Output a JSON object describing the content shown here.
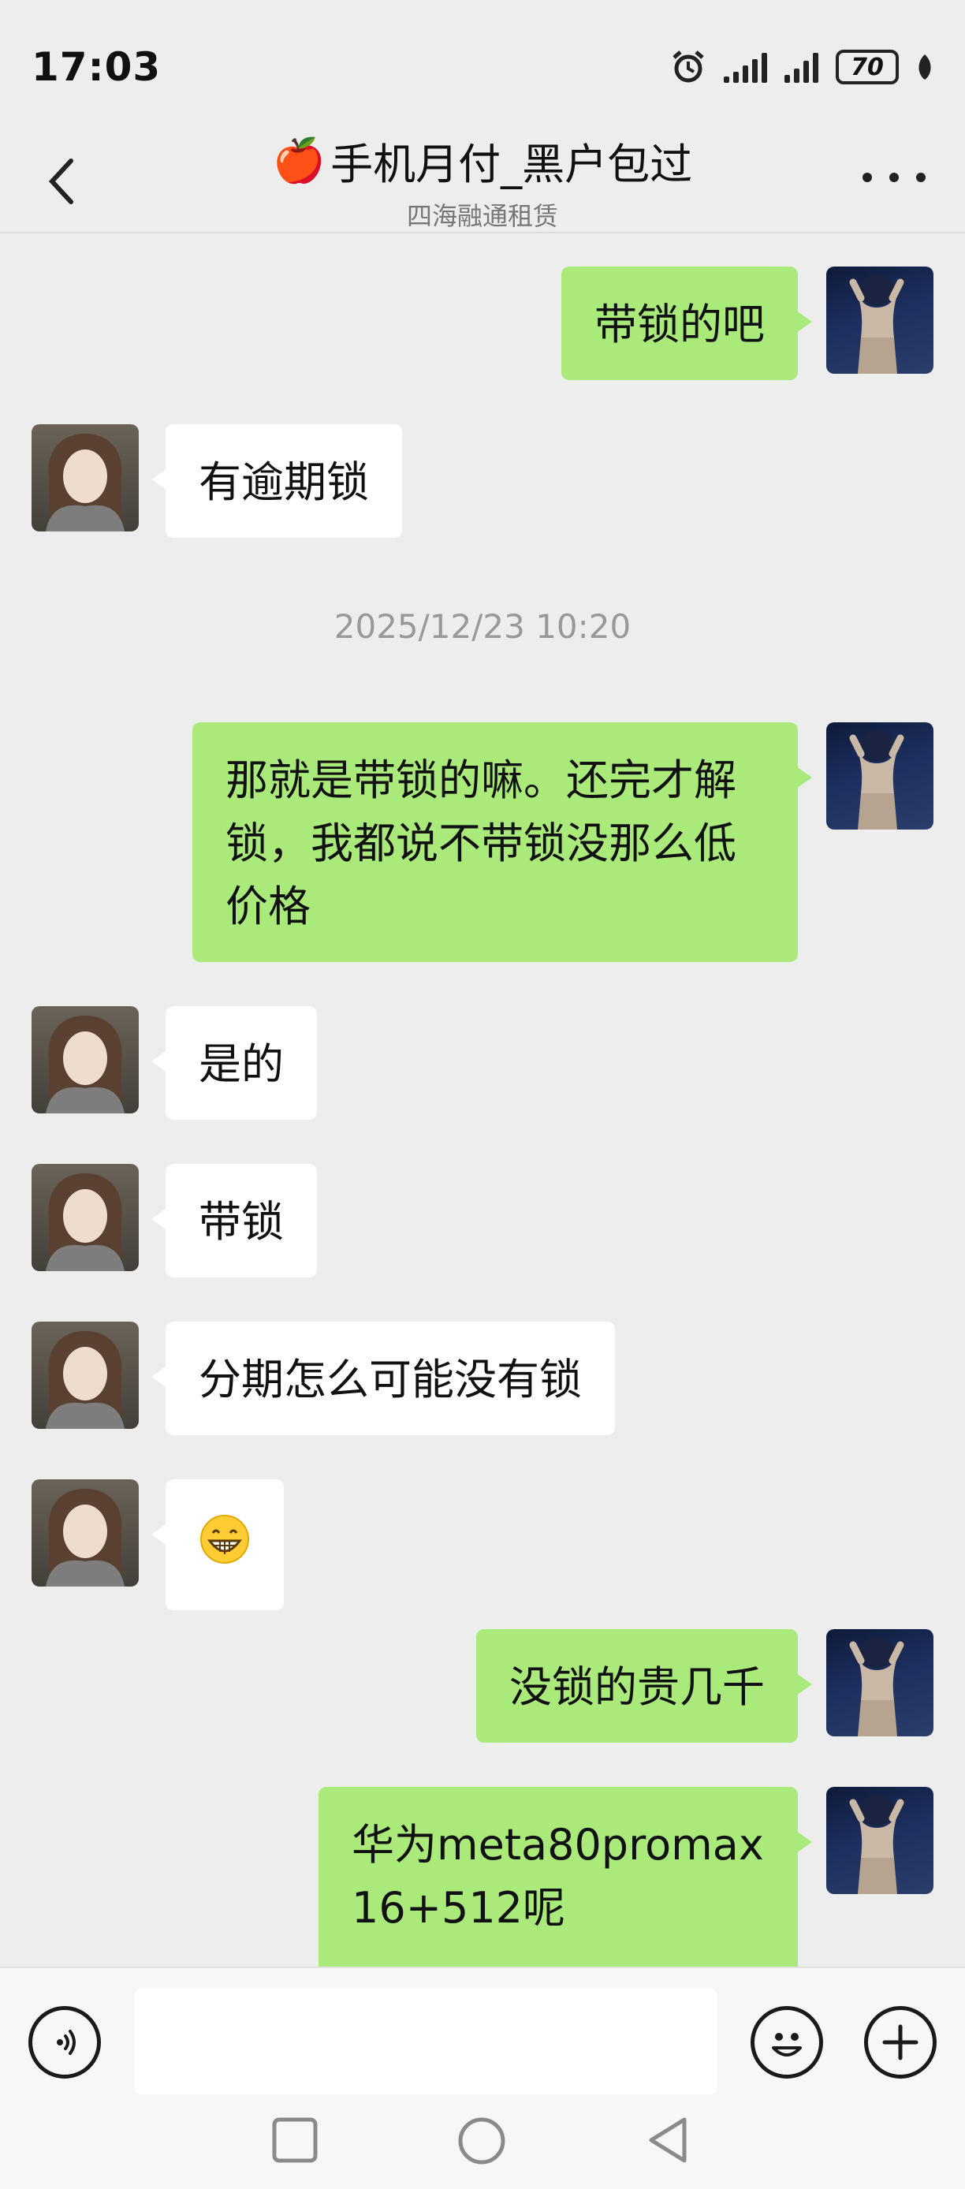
{
  "status_bar": {
    "time": "17:03",
    "battery": "70",
    "icons": [
      "alarm-icon",
      "signal-1-icon",
      "signal-2-icon",
      "battery-icon",
      "leaf-icon"
    ]
  },
  "header": {
    "title_emoji": "🍎",
    "title": "手机月付_黑户包过",
    "subtitle": "四海融通租赁",
    "back_icon": "chevron-left-icon",
    "more_icon": "more-dots-icon"
  },
  "messages": [
    {
      "side": "me",
      "text": "带锁的吧"
    },
    {
      "side": "them",
      "text": "有逾期锁"
    },
    {
      "side": "me",
      "lines": [
        "那就是带锁的嘛。还完才解",
        "锁，我都说不带锁没那么低",
        "价格"
      ]
    },
    {
      "side": "them",
      "text": "是的"
    },
    {
      "side": "them",
      "text": "带锁"
    },
    {
      "side": "them",
      "text": "分期怎么可能没有锁"
    },
    {
      "side": "them",
      "emoji": "😁",
      "emoji_name": "grinning-face-icon"
    },
    {
      "side": "me",
      "text": "没锁的贵几千"
    },
    {
      "side": "me",
      "lines": [
        "华为meta80promax",
        "16+512呢"
      ]
    }
  ],
  "timestamp": "2025/12/23 10:20",
  "input_bar": {
    "voice_icon": "voice-icon",
    "emoji_icon": "emoji-icon",
    "plus_icon": "plus-icon",
    "value": ""
  },
  "nav_bar": {
    "icons": [
      "square-icon",
      "circle-icon",
      "triangle-back-icon"
    ]
  },
  "colors": {
    "background": "#ededed",
    "my_bubble": "#a9ea7a",
    "their_bubble": "#ffffff",
    "timestamp": "#999999"
  }
}
